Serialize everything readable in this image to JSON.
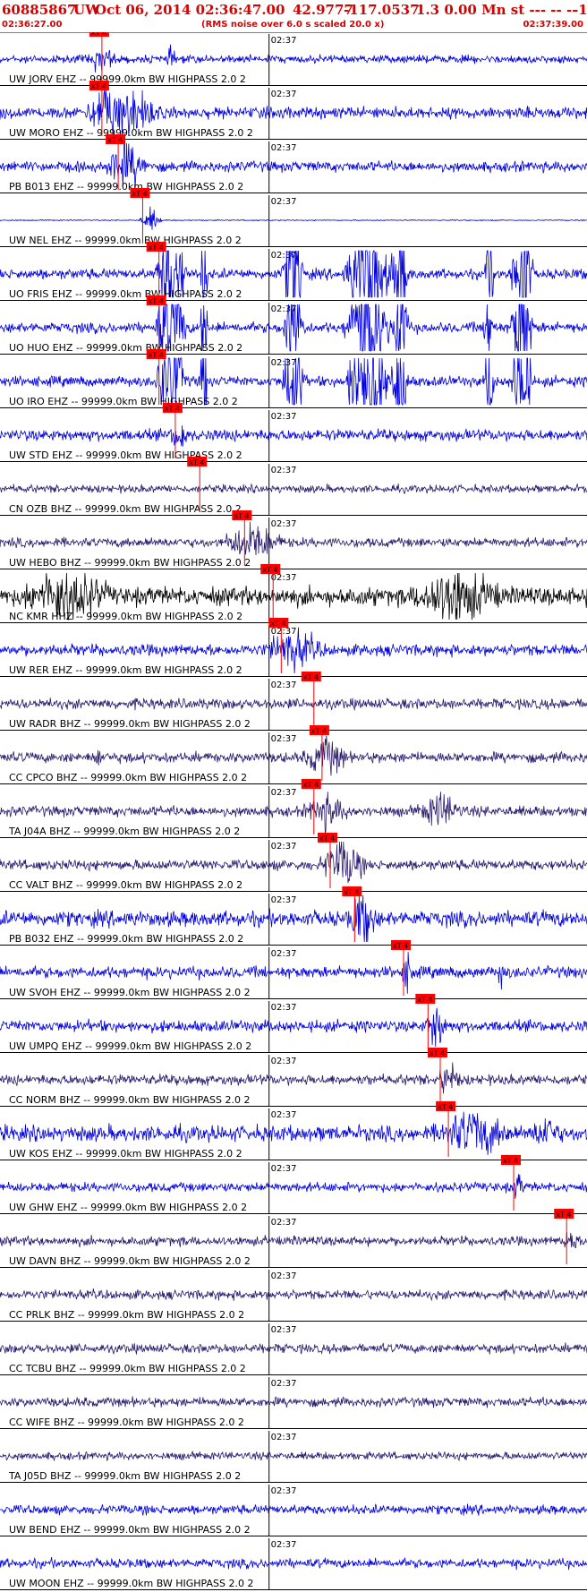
{
  "header": {
    "event_id": "60885867",
    "network": "UW",
    "origin_time": "Oct 06, 2014 02:36:47.00",
    "lat": "42.9777",
    "lon": "-117.0537",
    "info": "1.3 0.00 Mn st --- -- --",
    "tail": "-1",
    "start_time": "02:36:27.00",
    "end_time": "02:37:39.00",
    "note": "(RMS noise over 6.0 s scaled 20.0 x)"
  },
  "chart_data": {
    "type": "line",
    "title": "60885867 UW Oct 06, 2014 02:36:47.00 42.9777 -117.0537 1.3 0.00 Mn st --- -- -- -1",
    "subtitle": "(RMS noise over 6.0 s scaled 20.0 x)",
    "x_start": "02:36:27.00",
    "x_end": "02:37:39.00",
    "x_tick_label": "02:37",
    "x_range_seconds": [
      0,
      72
    ],
    "pick_label": "xT 4",
    "series": [
      {
        "name": "UW JORV EHZ -- 99999.0km BW HIGHPASS 2.0 2",
        "pick_s": 12.5,
        "color": "#0000dd",
        "amp": 0.15,
        "bursts": [
          [
            12.5,
            2.2,
            0.4
          ],
          [
            21,
            0.8,
            0.3
          ]
        ]
      },
      {
        "name": "UW MORO EHZ -- 99999.0km BW HIGHPASS 2.0 2",
        "pick_s": 12.5,
        "color": "#0000dd",
        "amp": 0.22,
        "bursts": [
          [
            15,
            5,
            1
          ],
          [
            12.8,
            1.5,
            0.6
          ]
        ]
      },
      {
        "name": "PB B013 EHZ -- 99999.0km BW HIGHPASS 2.0 2",
        "pick_s": 14.5,
        "color": "#0000dd",
        "amp": 0.2,
        "bursts": [
          [
            15.5,
            3,
            0.9
          ]
        ]
      },
      {
        "name": "UW NEL EHZ -- 99999.0km BW HIGHPASS 2.0 2",
        "pick_s": 17.5,
        "color": "#0000dd",
        "amp": 0.02,
        "bursts": [
          [
            18.5,
            1.5,
            0.5
          ]
        ]
      },
      {
        "name": "UO FRIS EHZ -- 99999.0km BW HIGHPASS 2.0 2",
        "pick_s": 19.5,
        "color": "#0000dd",
        "amp": 0.2,
        "bursts": [
          [
            21,
            2,
            3
          ],
          [
            25,
            0.5,
            3
          ],
          [
            36,
            1.5,
            3
          ],
          [
            45,
            3,
            3
          ],
          [
            49,
            1.2,
            3
          ],
          [
            60,
            0.7,
            3
          ],
          [
            64,
            1.5,
            3
          ]
        ]
      },
      {
        "name": "UO HUO EHZ -- 99999.0km BW HIGHPASS 2.0 2",
        "pick_s": 19.5,
        "color": "#0000dd",
        "amp": 0.2,
        "bursts": [
          [
            21,
            2,
            3
          ],
          [
            25,
            0.5,
            3
          ],
          [
            36,
            1.5,
            3
          ],
          [
            45,
            3,
            3
          ],
          [
            49,
            1.2,
            3
          ],
          [
            60,
            0.7,
            3
          ],
          [
            64,
            1.5,
            3
          ]
        ]
      },
      {
        "name": "UO IRO EHZ -- 99999.0km BW HIGHPASS 2.0 2",
        "pick_s": 19.5,
        "color": "#0000dd",
        "amp": 0.2,
        "bursts": [
          [
            21,
            2,
            3
          ],
          [
            25,
            0.5,
            3
          ],
          [
            36,
            1.5,
            3
          ],
          [
            45,
            3,
            3
          ],
          [
            49,
            1.2,
            3
          ],
          [
            60,
            0.7,
            3
          ],
          [
            64,
            1.5,
            3
          ]
        ]
      },
      {
        "name": "UW STD EHZ -- 99999.0km BW HIGHPASS 2.0 2",
        "pick_s": 21.5,
        "color": "#0000dd",
        "amp": 0.22,
        "bursts": [
          [
            22,
            1.2,
            0.6
          ]
        ]
      },
      {
        "name": "CN OZB BHZ -- 99999.0km BW HIGHPASS 2.0 2",
        "pick_s": 24.5,
        "color": "#2a1a6e",
        "amp": 0.15,
        "bursts": []
      },
      {
        "name": "UW HEBO BHZ -- 99999.0km BW HIGHPASS 2.0 2",
        "pick_s": 30,
        "color": "#2a1a6e",
        "amp": 0.18,
        "bursts": [
          [
            31,
            4,
            0.7
          ]
        ]
      },
      {
        "name": "NC KMR HHZ -- 99999.0km BW HIGHPASS 2.0 2",
        "pick_s": 33.5,
        "color": "#000000",
        "amp": 0.35,
        "bursts": [
          [
            8,
            6,
            1
          ],
          [
            56,
            6,
            1
          ]
        ]
      },
      {
        "name": "UW RER EHZ -- 99999.0km BW HIGHPASS 2.0 2",
        "pick_s": 34.5,
        "color": "#0000dd",
        "amp": 0.22,
        "bursts": [
          [
            36,
            4,
            0.7
          ]
        ]
      },
      {
        "name": "UW RADR BHZ -- 99999.0km BW HIGHPASS 2.0 2",
        "pick_s": 38.5,
        "color": "#2a1a6e",
        "amp": 0.2,
        "bursts": []
      },
      {
        "name": "CC CPCO BHZ -- 99999.0km BW HIGHPASS 2.0 2",
        "pick_s": 39.5,
        "color": "#2a1a6e",
        "amp": 0.2,
        "bursts": [
          [
            40,
            3,
            0.7
          ],
          [
            12,
            0.4,
            0.6
          ]
        ]
      },
      {
        "name": "TA J04A BHZ -- 99999.0km BW HIGHPASS 2.0 2",
        "pick_s": 38.5,
        "color": "#2a1a6e",
        "amp": 0.2,
        "bursts": [
          [
            40,
            3,
            0.6
          ],
          [
            54,
            3,
            0.6
          ]
        ]
      },
      {
        "name": "CC VALT BHZ -- 99999.0km BW HIGHPASS 2.0 2",
        "pick_s": 40.5,
        "color": "#2a1a6e",
        "amp": 0.2,
        "bursts": [
          [
            42,
            3,
            1
          ]
        ]
      },
      {
        "name": "PB B032 EHZ -- 99999.0km BW HIGHPASS 2.0 2",
        "pick_s": 43.5,
        "color": "#0000dd",
        "amp": 0.3,
        "bursts": [
          [
            44.5,
            2,
            1
          ]
        ]
      },
      {
        "name": "UW SVOH EHZ -- 99999.0km BW HIGHPASS 2.0 2",
        "pick_s": 49.5,
        "color": "#0000dd",
        "amp": 0.22,
        "bursts": [
          [
            50,
            1,
            0.6
          ],
          [
            61.5,
            0.4,
            0.8
          ]
        ]
      },
      {
        "name": "UW UMPQ EHZ -- 99999.0km BW HIGHPASS 2.0 2",
        "pick_s": 52.5,
        "color": "#0000dd",
        "amp": 0.22,
        "bursts": [
          [
            53.5,
            1.5,
            0.9
          ]
        ]
      },
      {
        "name": "CC NORM BHZ -- 99999.0km BW HIGHPASS 2.0 2",
        "pick_s": 54,
        "color": "#2a1a6e",
        "amp": 0.2,
        "bursts": [
          [
            55,
            1.5,
            0.7
          ]
        ]
      },
      {
        "name": "UW KOS EHZ -- 99999.0km BW HIGHPASS 2.0 2",
        "pick_s": 55,
        "color": "#0000dd",
        "amp": 0.3,
        "bursts": [
          [
            58,
            5,
            0.8
          ],
          [
            67,
            2,
            0.6
          ]
        ]
      },
      {
        "name": "UW GHW EHZ -- 99999.0km BW HIGHPASS 2.0 2",
        "pick_s": 63,
        "color": "#0000dd",
        "amp": 0.18,
        "bursts": [
          [
            63.5,
            0.8,
            0.5
          ]
        ]
      },
      {
        "name": "UW DAVN BHZ -- 99999.0km BW HIGHPASS 2.0 2",
        "pick_s": 69.5,
        "color": "#2a1a6e",
        "amp": 0.18,
        "bursts": [
          [
            70,
            1,
            0.5
          ]
        ]
      },
      {
        "name": "CC PRLK BHZ -- 99999.0km BW HIGHPASS 2.0 2",
        "pick_s": null,
        "color": "#2a1a6e",
        "amp": 0.18,
        "bursts": []
      },
      {
        "name": "CC TCBU BHZ -- 99999.0km BW HIGHPASS 2.0 2",
        "pick_s": null,
        "color": "#2a1a6e",
        "amp": 0.18,
        "bursts": []
      },
      {
        "name": "CC WIFE BHZ -- 99999.0km BW HIGHPASS 2.0 2",
        "pick_s": null,
        "color": "#2a1a6e",
        "amp": 0.18,
        "bursts": []
      },
      {
        "name": "TA J05D BHZ -- 99999.0km BW HIGHPASS 2.0 2",
        "pick_s": null,
        "color": "#2a1a6e",
        "amp": 0.15,
        "bursts": []
      },
      {
        "name": "UW BEND EHZ -- 99999.0km BW HIGHPASS 2.0 2",
        "pick_s": null,
        "color": "#0000dd",
        "amp": 0.18,
        "bursts": []
      },
      {
        "name": "UW MOON EHZ -- 99999.0km BW HIGHPASS 2.0 2",
        "pick_s": null,
        "color": "#0000dd",
        "amp": 0.18,
        "bursts": []
      }
    ]
  },
  "colors": {
    "header_text": "#d90000",
    "pick_box": "#ff0000",
    "pick_line": "#ff0000"
  }
}
